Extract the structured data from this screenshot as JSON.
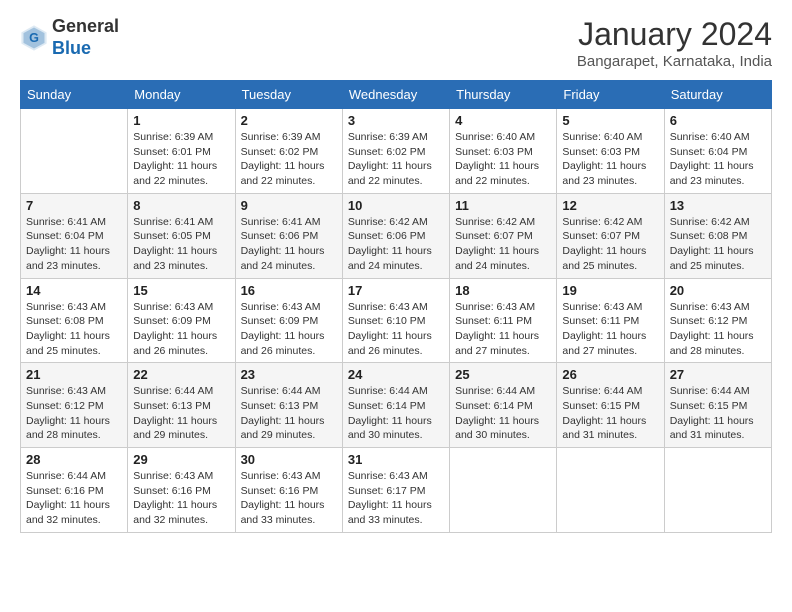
{
  "logo": {
    "general": "General",
    "blue": "Blue"
  },
  "title": "January 2024",
  "subtitle": "Bangarapet, Karnataka, India",
  "days_header": [
    "Sunday",
    "Monday",
    "Tuesday",
    "Wednesday",
    "Thursday",
    "Friday",
    "Saturday"
  ],
  "weeks": [
    [
      {
        "day": "",
        "sunrise": "",
        "sunset": "",
        "daylight": ""
      },
      {
        "day": "1",
        "sunrise": "Sunrise: 6:39 AM",
        "sunset": "Sunset: 6:01 PM",
        "daylight": "Daylight: 11 hours and 22 minutes."
      },
      {
        "day": "2",
        "sunrise": "Sunrise: 6:39 AM",
        "sunset": "Sunset: 6:02 PM",
        "daylight": "Daylight: 11 hours and 22 minutes."
      },
      {
        "day": "3",
        "sunrise": "Sunrise: 6:39 AM",
        "sunset": "Sunset: 6:02 PM",
        "daylight": "Daylight: 11 hours and 22 minutes."
      },
      {
        "day": "4",
        "sunrise": "Sunrise: 6:40 AM",
        "sunset": "Sunset: 6:03 PM",
        "daylight": "Daylight: 11 hours and 22 minutes."
      },
      {
        "day": "5",
        "sunrise": "Sunrise: 6:40 AM",
        "sunset": "Sunset: 6:03 PM",
        "daylight": "Daylight: 11 hours and 23 minutes."
      },
      {
        "day": "6",
        "sunrise": "Sunrise: 6:40 AM",
        "sunset": "Sunset: 6:04 PM",
        "daylight": "Daylight: 11 hours and 23 minutes."
      }
    ],
    [
      {
        "day": "7",
        "sunrise": "Sunrise: 6:41 AM",
        "sunset": "Sunset: 6:04 PM",
        "daylight": "Daylight: 11 hours and 23 minutes."
      },
      {
        "day": "8",
        "sunrise": "Sunrise: 6:41 AM",
        "sunset": "Sunset: 6:05 PM",
        "daylight": "Daylight: 11 hours and 23 minutes."
      },
      {
        "day": "9",
        "sunrise": "Sunrise: 6:41 AM",
        "sunset": "Sunset: 6:06 PM",
        "daylight": "Daylight: 11 hours and 24 minutes."
      },
      {
        "day": "10",
        "sunrise": "Sunrise: 6:42 AM",
        "sunset": "Sunset: 6:06 PM",
        "daylight": "Daylight: 11 hours and 24 minutes."
      },
      {
        "day": "11",
        "sunrise": "Sunrise: 6:42 AM",
        "sunset": "Sunset: 6:07 PM",
        "daylight": "Daylight: 11 hours and 24 minutes."
      },
      {
        "day": "12",
        "sunrise": "Sunrise: 6:42 AM",
        "sunset": "Sunset: 6:07 PM",
        "daylight": "Daylight: 11 hours and 25 minutes."
      },
      {
        "day": "13",
        "sunrise": "Sunrise: 6:42 AM",
        "sunset": "Sunset: 6:08 PM",
        "daylight": "Daylight: 11 hours and 25 minutes."
      }
    ],
    [
      {
        "day": "14",
        "sunrise": "Sunrise: 6:43 AM",
        "sunset": "Sunset: 6:08 PM",
        "daylight": "Daylight: 11 hours and 25 minutes."
      },
      {
        "day": "15",
        "sunrise": "Sunrise: 6:43 AM",
        "sunset": "Sunset: 6:09 PM",
        "daylight": "Daylight: 11 hours and 26 minutes."
      },
      {
        "day": "16",
        "sunrise": "Sunrise: 6:43 AM",
        "sunset": "Sunset: 6:09 PM",
        "daylight": "Daylight: 11 hours and 26 minutes."
      },
      {
        "day": "17",
        "sunrise": "Sunrise: 6:43 AM",
        "sunset": "Sunset: 6:10 PM",
        "daylight": "Daylight: 11 hours and 26 minutes."
      },
      {
        "day": "18",
        "sunrise": "Sunrise: 6:43 AM",
        "sunset": "Sunset: 6:11 PM",
        "daylight": "Daylight: 11 hours and 27 minutes."
      },
      {
        "day": "19",
        "sunrise": "Sunrise: 6:43 AM",
        "sunset": "Sunset: 6:11 PM",
        "daylight": "Daylight: 11 hours and 27 minutes."
      },
      {
        "day": "20",
        "sunrise": "Sunrise: 6:43 AM",
        "sunset": "Sunset: 6:12 PM",
        "daylight": "Daylight: 11 hours and 28 minutes."
      }
    ],
    [
      {
        "day": "21",
        "sunrise": "Sunrise: 6:43 AM",
        "sunset": "Sunset: 6:12 PM",
        "daylight": "Daylight: 11 hours and 28 minutes."
      },
      {
        "day": "22",
        "sunrise": "Sunrise: 6:44 AM",
        "sunset": "Sunset: 6:13 PM",
        "daylight": "Daylight: 11 hours and 29 minutes."
      },
      {
        "day": "23",
        "sunrise": "Sunrise: 6:44 AM",
        "sunset": "Sunset: 6:13 PM",
        "daylight": "Daylight: 11 hours and 29 minutes."
      },
      {
        "day": "24",
        "sunrise": "Sunrise: 6:44 AM",
        "sunset": "Sunset: 6:14 PM",
        "daylight": "Daylight: 11 hours and 30 minutes."
      },
      {
        "day": "25",
        "sunrise": "Sunrise: 6:44 AM",
        "sunset": "Sunset: 6:14 PM",
        "daylight": "Daylight: 11 hours and 30 minutes."
      },
      {
        "day": "26",
        "sunrise": "Sunrise: 6:44 AM",
        "sunset": "Sunset: 6:15 PM",
        "daylight": "Daylight: 11 hours and 31 minutes."
      },
      {
        "day": "27",
        "sunrise": "Sunrise: 6:44 AM",
        "sunset": "Sunset: 6:15 PM",
        "daylight": "Daylight: 11 hours and 31 minutes."
      }
    ],
    [
      {
        "day": "28",
        "sunrise": "Sunrise: 6:44 AM",
        "sunset": "Sunset: 6:16 PM",
        "daylight": "Daylight: 11 hours and 32 minutes."
      },
      {
        "day": "29",
        "sunrise": "Sunrise: 6:43 AM",
        "sunset": "Sunset: 6:16 PM",
        "daylight": "Daylight: 11 hours and 32 minutes."
      },
      {
        "day": "30",
        "sunrise": "Sunrise: 6:43 AM",
        "sunset": "Sunset: 6:16 PM",
        "daylight": "Daylight: 11 hours and 33 minutes."
      },
      {
        "day": "31",
        "sunrise": "Sunrise: 6:43 AM",
        "sunset": "Sunset: 6:17 PM",
        "daylight": "Daylight: 11 hours and 33 minutes."
      },
      {
        "day": "",
        "sunrise": "",
        "sunset": "",
        "daylight": ""
      },
      {
        "day": "",
        "sunrise": "",
        "sunset": "",
        "daylight": ""
      },
      {
        "day": "",
        "sunrise": "",
        "sunset": "",
        "daylight": ""
      }
    ]
  ]
}
